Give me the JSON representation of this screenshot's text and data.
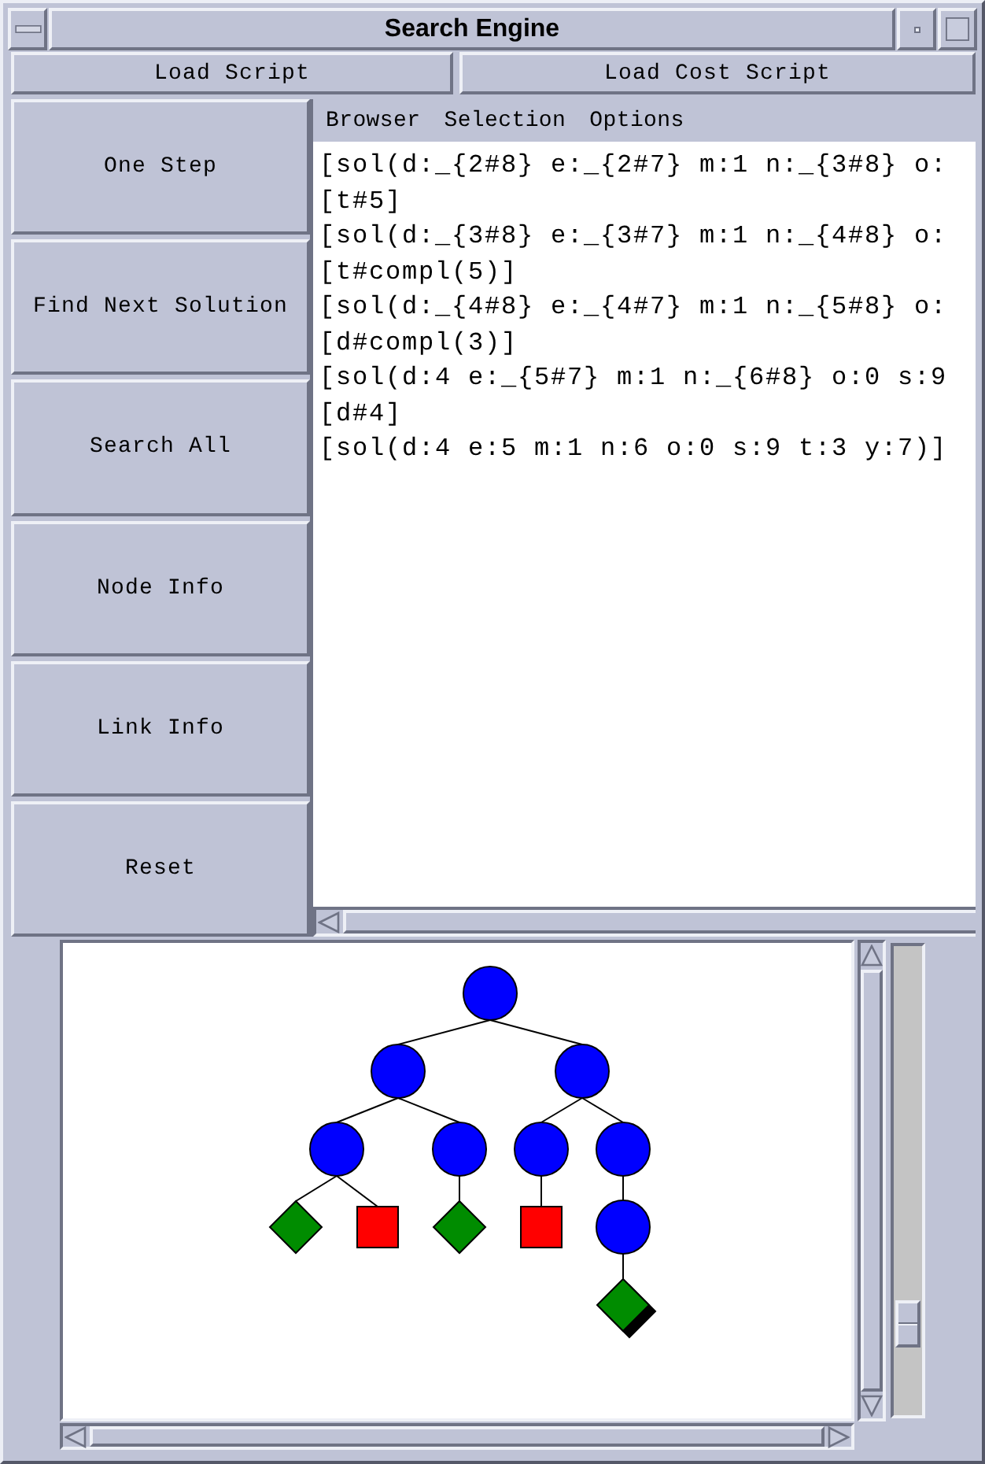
{
  "window": {
    "title": "Search Engine"
  },
  "toolbar": {
    "buttons": [
      "Load Script",
      "Load Cost Script"
    ]
  },
  "commands": [
    "One Step",
    "Find Next Solution",
    "Search All",
    "Node Info",
    "Link Info",
    "Reset"
  ],
  "menu_bar": [
    "Browser",
    "Selection",
    "Options"
  ],
  "output": {
    "lines": [
      "[sol(d:_{2#8} e:_{2#7} m:1 n:_{3#8} o:",
      "[t#5]",
      "[sol(d:_{3#8} e:_{3#7} m:1 n:_{4#8} o:",
      "[t#compl(5)]",
      "[sol(d:_{4#8} e:_{4#7} m:1 n:_{5#8} o:",
      "[d#compl(3)]",
      "[sol(d:4 e:_{5#7} m:1 n:_{6#8} o:0 s:9",
      "[d#4]",
      "[sol(d:4 e:5 m:1 n:6 o:0 s:9 t:3 y:7)]"
    ]
  },
  "tree": {
    "kind": "circle",
    "selected": false,
    "children": [
      {
        "kind": "circle",
        "selected": false,
        "children": [
          {
            "kind": "circle",
            "selected": false,
            "children": [
              {
                "kind": "diamond",
                "selected": false
              },
              {
                "kind": "square",
                "selected": false
              }
            ]
          },
          {
            "kind": "circle",
            "selected": false,
            "children": [
              {
                "kind": "diamond",
                "selected": false
              }
            ]
          }
        ]
      },
      {
        "kind": "circle",
        "selected": false,
        "children": [
          {
            "kind": "circle",
            "selected": false,
            "children": [
              {
                "kind": "square",
                "selected": false
              }
            ]
          },
          {
            "kind": "circle",
            "selected": false,
            "children": [
              {
                "kind": "circle",
                "selected": false,
                "children": [
                  {
                    "kind": "diamond",
                    "selected": true
                  }
                ]
              }
            ]
          }
        ]
      }
    ]
  },
  "slider": {
    "level": 0.84
  }
}
